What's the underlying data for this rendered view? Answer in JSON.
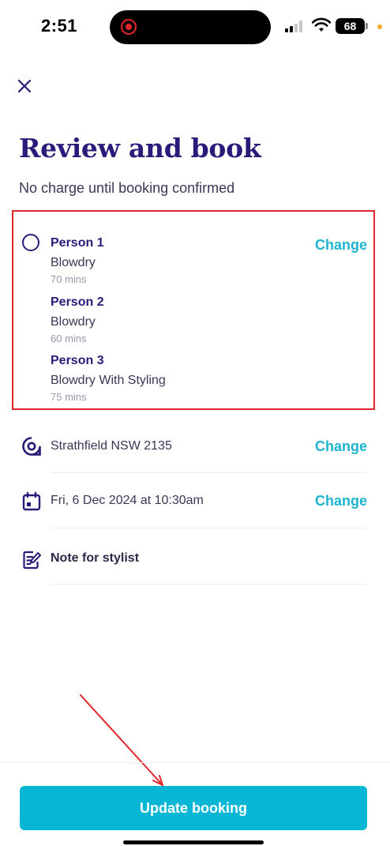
{
  "status_bar": {
    "time": "2:51",
    "battery": "68"
  },
  "header": {
    "title": "Review and book",
    "subtitle": "No charge until booking confirmed"
  },
  "persons": [
    {
      "name": "Person 1",
      "service": "Blowdry",
      "duration": "70 mins"
    },
    {
      "name": "Person 2",
      "service": "Blowdry",
      "duration": "60 mins"
    },
    {
      "name": "Person 3",
      "service": "Blowdry With Styling",
      "duration": "75 mins"
    }
  ],
  "persons_change_label": "Change",
  "location": {
    "text": "Strathfield NSW 2135",
    "change_label": "Change"
  },
  "datetime": {
    "text": "Fri, 6 Dec 2024 at 10:30am",
    "change_label": "Change"
  },
  "note": {
    "label": "Note for stylist"
  },
  "cta": {
    "label": "Update booking"
  },
  "colors": {
    "brand": "#2b1a7a",
    "accent": "#06b6d4",
    "annotation": "#e0262b"
  },
  "icons": [
    "close-icon",
    "radio-icon",
    "location-pin-icon",
    "calendar-icon",
    "note-edit-icon"
  ]
}
